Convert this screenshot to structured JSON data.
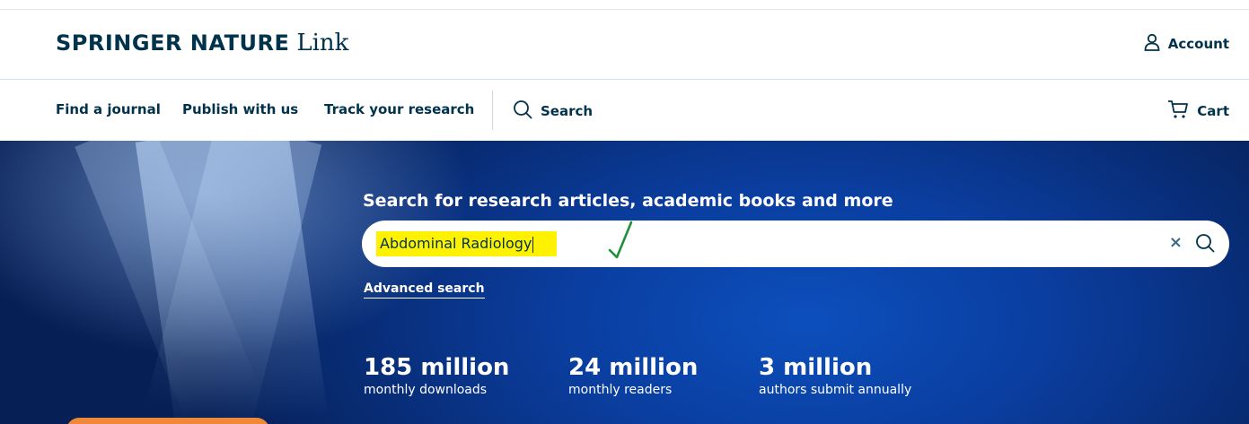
{
  "header": {
    "brand_bold": "SPRINGER NATURE",
    "brand_light": "Link",
    "account_label": "Account"
  },
  "nav": {
    "items": [
      {
        "label": "Find a journal"
      },
      {
        "label": "Publish with us"
      },
      {
        "label": "Track your research"
      }
    ],
    "search_label": "Search",
    "cart_label": "Cart"
  },
  "hero": {
    "heading": "Search for research articles, academic books and more",
    "search": {
      "value": "Abdominal Radiology",
      "clear_symbol": "×"
    },
    "advanced_search_label": "Advanced search",
    "stats": [
      {
        "number": "185 million",
        "label": "monthly downloads"
      },
      {
        "number": "24 million",
        "label": "monthly readers"
      },
      {
        "number": "3 million",
        "label": "authors submit annually"
      }
    ]
  },
  "annotations": {
    "highlight_color": "#fff200",
    "checkmark_color": "#1f8f3a"
  },
  "colors": {
    "brand_navy": "#01324b",
    "hero_blue": "#0a3d9e",
    "cta_orange": "#f0883a"
  },
  "icons": [
    "person-icon",
    "search-icon",
    "cart-icon",
    "close-icon",
    "check-mark-icon"
  ]
}
